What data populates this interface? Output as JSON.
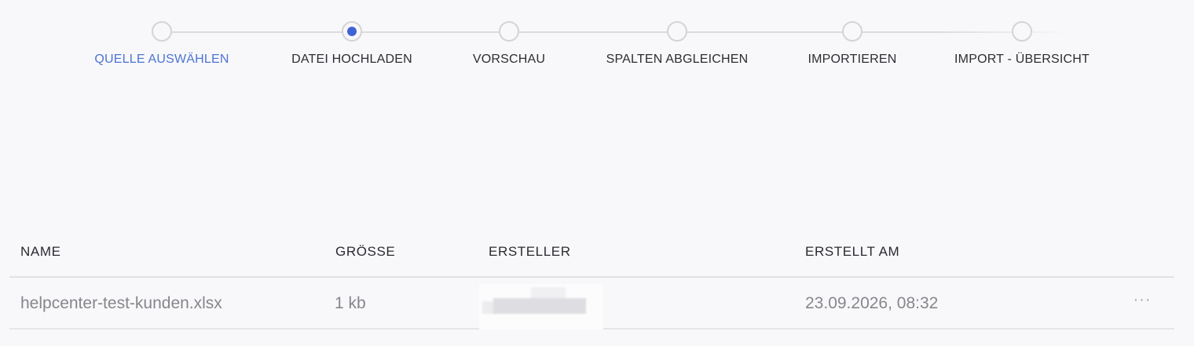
{
  "stepper": {
    "steps": [
      {
        "label": "QUELLE AUSWÄHLEN",
        "state": "completed"
      },
      {
        "label": "DATEI HOCHLADEN",
        "state": "active"
      },
      {
        "label": "VORSCHAU",
        "state": "pending"
      },
      {
        "label": "SPALTEN ABGLEICHEN",
        "state": "pending"
      },
      {
        "label": "IMPORTIEREN",
        "state": "pending"
      },
      {
        "label": "IMPORT - ÜBERSICHT",
        "state": "pending"
      }
    ],
    "colors": {
      "active": "#3f63d6",
      "completed": "#4d74d4",
      "pending": "#2d2d33"
    }
  },
  "table": {
    "headers": {
      "name": "NAME",
      "size": "GRÖSSE",
      "creator": "ERSTELLER",
      "created_at": "ERSTELLT AM"
    },
    "rows": [
      {
        "name": "helpcenter-test-kunden.xlsx",
        "size": "1 kb",
        "creator": "",
        "created_at": "23.09.2026, 08:32",
        "actions_icon": "more-horizontal-icon",
        "actions_label": "···"
      }
    ]
  }
}
